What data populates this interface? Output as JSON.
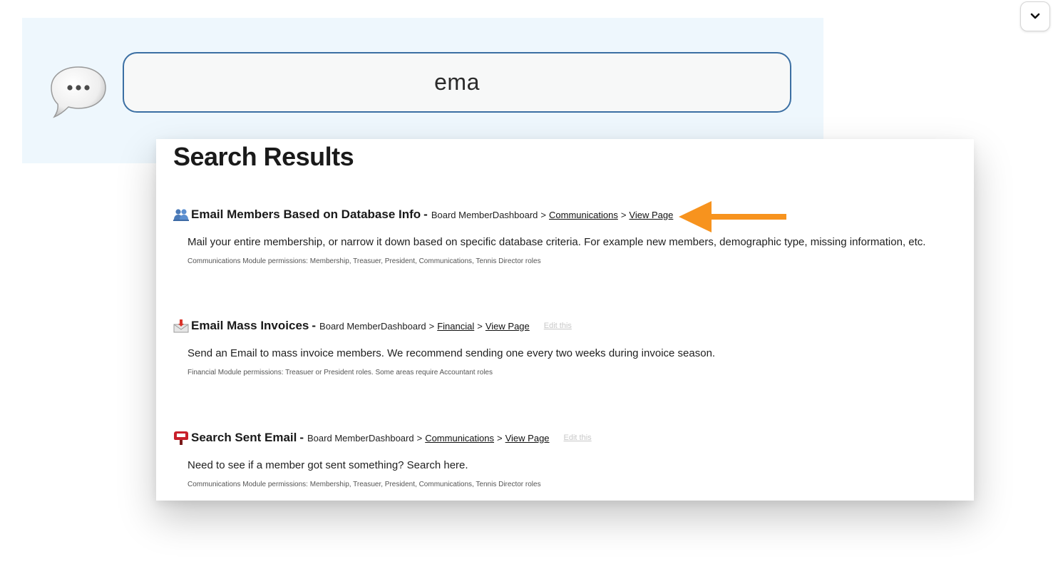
{
  "search": {
    "query": "ema"
  },
  "results": {
    "title": "Search Results",
    "items": [
      {
        "icon": "people-icon",
        "title": "Email Members Based on Database Info",
        "separator": "-",
        "crumb_root": "Board MemberDashboard",
        "crumb_section": "Communications",
        "view_link": "View Page",
        "edit_label": "",
        "description": "Mail your entire membership, or narrow it down based on specific database criteria. For example new members, demographic type, missing information, etc.",
        "permissions": "Communications Module permissions: Membership, Treasuer, President, Communications, Tennis Director roles"
      },
      {
        "icon": "envelope-icon",
        "title": "Email Mass Invoices",
        "separator": "-",
        "crumb_root": "Board MemberDashboard",
        "crumb_section": "Financial",
        "view_link": "View Page",
        "edit_label": "Edit this",
        "description": "Send an Email to mass invoice members. We recommend sending one every two weeks during invoice season.",
        "permissions": "Financial Module permissions: Treasuer or President roles. Some areas require Accountant roles"
      },
      {
        "icon": "mailbox-icon",
        "title": "Search Sent Email",
        "separator": "-",
        "crumb_root": "Board MemberDashboard",
        "crumb_section": "Communications",
        "view_link": "View Page",
        "edit_label": "Edit this",
        "description": "Need to see if a member got sent something? Search here.",
        "permissions": "Communications Module permissions: Membership, Treasuer, President, Communications, Tennis Director roles"
      }
    ]
  },
  "colors": {
    "panel_bg": "#eef7fd",
    "search_border": "#3b6fa3",
    "arrow": "#f7931e"
  }
}
